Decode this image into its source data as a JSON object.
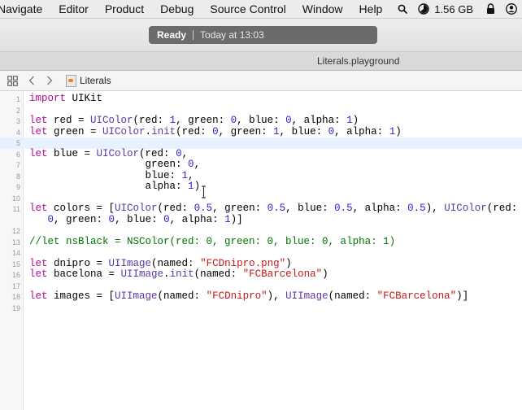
{
  "menubar": {
    "items": [
      "Navigate",
      "Editor",
      "Product",
      "Debug",
      "Source Control",
      "Window",
      "Help"
    ],
    "memory": "1.56 GB",
    "icons": [
      "spotlight-icon",
      "memory-gauge-icon",
      "lock-icon",
      "user-icon"
    ]
  },
  "toolbar": {
    "status": "Ready",
    "time": "Today at 13:03"
  },
  "tab": {
    "title": "Literals.playground"
  },
  "jumpbar": {
    "breadcrumb": "Literals"
  },
  "code": {
    "lines": [
      {
        "n": "1",
        "tokens": [
          {
            "t": "import",
            "c": "kw"
          },
          {
            "t": " UIKit",
            "c": ""
          }
        ]
      },
      {
        "n": "2",
        "tokens": []
      },
      {
        "n": "3",
        "tokens": [
          {
            "t": "let",
            "c": "kw"
          },
          {
            "t": " red = ",
            "c": ""
          },
          {
            "t": "UIColor",
            "c": "ty"
          },
          {
            "t": "(red: ",
            "c": ""
          },
          {
            "t": "1",
            "c": "num"
          },
          {
            "t": ", green: ",
            "c": ""
          },
          {
            "t": "0",
            "c": "num"
          },
          {
            "t": ", blue: ",
            "c": ""
          },
          {
            "t": "0",
            "c": "num"
          },
          {
            "t": ", alpha: ",
            "c": ""
          },
          {
            "t": "1",
            "c": "num"
          },
          {
            "t": ")",
            "c": ""
          }
        ]
      },
      {
        "n": "4",
        "tokens": [
          {
            "t": "let",
            "c": "kw"
          },
          {
            "t": " green = ",
            "c": ""
          },
          {
            "t": "UIColor",
            "c": "ty"
          },
          {
            "t": ".",
            "c": ""
          },
          {
            "t": "init",
            "c": "ty"
          },
          {
            "t": "(red: ",
            "c": ""
          },
          {
            "t": "0",
            "c": "num"
          },
          {
            "t": ", green: ",
            "c": ""
          },
          {
            "t": "1",
            "c": "num"
          },
          {
            "t": ", blue: ",
            "c": ""
          },
          {
            "t": "0",
            "c": "num"
          },
          {
            "t": ", alpha: ",
            "c": ""
          },
          {
            "t": "1",
            "c": "num"
          },
          {
            "t": ")",
            "c": ""
          }
        ]
      },
      {
        "n": "5",
        "tokens": [],
        "current": true
      },
      {
        "n": "6",
        "tokens": [
          {
            "t": "let",
            "c": "kw"
          },
          {
            "t": " blue = ",
            "c": ""
          },
          {
            "t": "UIColor",
            "c": "ty"
          },
          {
            "t": "(red: ",
            "c": ""
          },
          {
            "t": "0",
            "c": "num"
          },
          {
            "t": ",",
            "c": ""
          }
        ]
      },
      {
        "n": "7",
        "tokens": [
          {
            "t": "                   green: ",
            "c": ""
          },
          {
            "t": "0",
            "c": "num"
          },
          {
            "t": ",",
            "c": ""
          }
        ]
      },
      {
        "n": "8",
        "tokens": [
          {
            "t": "                   blue: ",
            "c": ""
          },
          {
            "t": "1",
            "c": "num"
          },
          {
            "t": ",",
            "c": ""
          }
        ]
      },
      {
        "n": "9",
        "tokens": [
          {
            "t": "                   alpha: ",
            "c": ""
          },
          {
            "t": "1",
            "c": "num"
          },
          {
            "t": ")",
            "c": ""
          }
        ]
      },
      {
        "n": "10",
        "tokens": []
      },
      {
        "n": "11",
        "tokens": [
          {
            "t": "let",
            "c": "kw"
          },
          {
            "t": " colors = [",
            "c": ""
          },
          {
            "t": "UIColor",
            "c": "ty"
          },
          {
            "t": "(red: ",
            "c": ""
          },
          {
            "t": "0.5",
            "c": "num"
          },
          {
            "t": ", green: ",
            "c": ""
          },
          {
            "t": "0.5",
            "c": "num"
          },
          {
            "t": ", blue: ",
            "c": ""
          },
          {
            "t": "0.5",
            "c": "num"
          },
          {
            "t": ", alpha: ",
            "c": ""
          },
          {
            "t": "0.5",
            "c": "num"
          },
          {
            "t": "), ",
            "c": ""
          },
          {
            "t": "UIColor",
            "c": "ty"
          },
          {
            "t": "(red:",
            "c": ""
          }
        ]
      },
      {
        "n": "",
        "tokens": [
          {
            "t": "   ",
            "c": ""
          },
          {
            "t": "0",
            "c": "num"
          },
          {
            "t": ", green: ",
            "c": ""
          },
          {
            "t": "0",
            "c": "num"
          },
          {
            "t": ", blue: ",
            "c": ""
          },
          {
            "t": "0",
            "c": "num"
          },
          {
            "t": ", alpha: ",
            "c": ""
          },
          {
            "t": "1",
            "c": "num"
          },
          {
            "t": ")]",
            "c": ""
          }
        ]
      },
      {
        "n": "12",
        "tokens": []
      },
      {
        "n": "13",
        "tokens": [
          {
            "t": "//let nsBlack = NSColor(red: 0, green: 0, blue: 0, alpha: 1)",
            "c": "cm"
          }
        ]
      },
      {
        "n": "14",
        "tokens": []
      },
      {
        "n": "15",
        "tokens": [
          {
            "t": "let",
            "c": "kw"
          },
          {
            "t": " dnipro = ",
            "c": ""
          },
          {
            "t": "UIImage",
            "c": "ty"
          },
          {
            "t": "(named: ",
            "c": ""
          },
          {
            "t": "\"FCDnipro.png\"",
            "c": "str"
          },
          {
            "t": ")",
            "c": ""
          }
        ]
      },
      {
        "n": "16",
        "tokens": [
          {
            "t": "let",
            "c": "kw"
          },
          {
            "t": " bacelona = ",
            "c": ""
          },
          {
            "t": "UIImage",
            "c": "ty"
          },
          {
            "t": ".",
            "c": ""
          },
          {
            "t": "init",
            "c": "ty"
          },
          {
            "t": "(named: ",
            "c": ""
          },
          {
            "t": "\"FCBarcelona\"",
            "c": "str"
          },
          {
            "t": ")",
            "c": ""
          }
        ]
      },
      {
        "n": "17",
        "tokens": []
      },
      {
        "n": "18",
        "tokens": [
          {
            "t": "let",
            "c": "kw"
          },
          {
            "t": " images = [",
            "c": ""
          },
          {
            "t": "UIImage",
            "c": "ty"
          },
          {
            "t": "(named: ",
            "c": ""
          },
          {
            "t": "\"FCDnipro\"",
            "c": "str"
          },
          {
            "t": "), ",
            "c": ""
          },
          {
            "t": "UIImage",
            "c": "ty"
          },
          {
            "t": "(named: ",
            "c": ""
          },
          {
            "t": "\"FCBarcelona\"",
            "c": "str"
          },
          {
            "t": ")]",
            "c": ""
          }
        ]
      },
      {
        "n": "19",
        "tokens": []
      }
    ]
  },
  "colors": {
    "keyword": "#b30a97",
    "type": "#5a37a8",
    "number": "#2a24d4",
    "string": "#c41a16",
    "comment": "#007400"
  }
}
